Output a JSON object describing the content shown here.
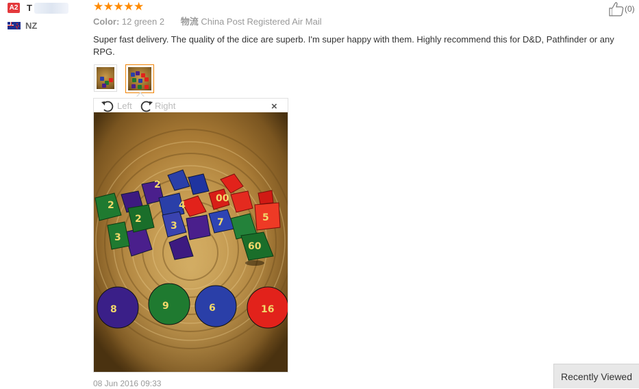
{
  "reviewer": {
    "level_badge": "A2",
    "name": "T",
    "country": "NZ"
  },
  "review": {
    "rating_stars": "★★★★★",
    "color_label": "Color:",
    "color_value": "12 green 2",
    "shipping_label": "物流",
    "shipping_value": "China Post Registered Air Mail",
    "text": "Super fast delivery. The quality of the dice are superb. I'm super happy with them. Highly recommend this for D&D, Pathfinder or any RPG.",
    "date": "08 Jun 2016 09:33"
  },
  "viewer": {
    "rotate_left_label": "Left",
    "rotate_right_label": "Right",
    "close_label": "×"
  },
  "helpful": {
    "count": "(0)"
  },
  "recently_viewed": "Recently Viewed",
  "colors": {
    "star": "#ff8a00",
    "badge": "#e4393c",
    "thumb_active_border": "#f08200",
    "dice_blue": "#2a3fa8",
    "dice_purple": "#4a1f8c",
    "dice_green": "#1f7a30",
    "dice_red": "#e2221b"
  }
}
